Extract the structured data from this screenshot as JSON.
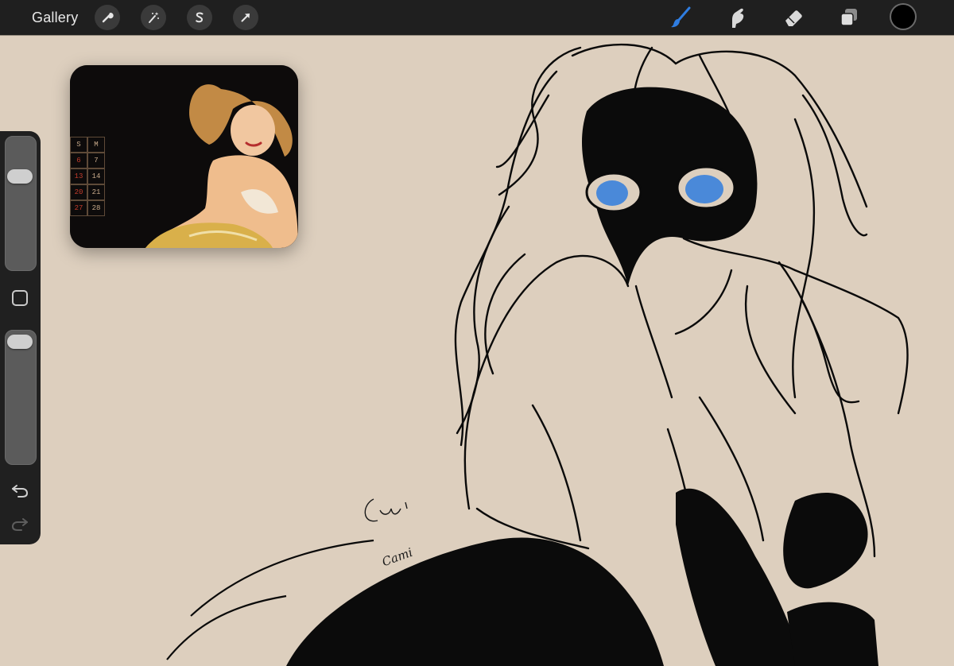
{
  "app": {
    "gallery_label": "Gallery",
    "accent_color": "#2f7de1",
    "current_color": "#000000"
  },
  "toolbar_left": [
    {
      "name": "actions-wrench-icon"
    },
    {
      "name": "adjustments-magic-wand-icon"
    },
    {
      "name": "selection-s-icon"
    },
    {
      "name": "transform-arrow-icon"
    }
  ],
  "toolbar_right": [
    {
      "name": "paint-brush-icon",
      "active": true
    },
    {
      "name": "smudge-finger-icon",
      "active": false
    },
    {
      "name": "eraser-icon",
      "active": false
    },
    {
      "name": "layers-icon",
      "active": false
    }
  ],
  "reference": {
    "calendar": {
      "headers": [
        "S",
        "M"
      ],
      "rows": [
        [
          "6",
          "7"
        ],
        [
          "13",
          "14"
        ],
        [
          "20",
          "21"
        ],
        [
          "27",
          "28"
        ]
      ]
    }
  },
  "canvas": {
    "signature": "Cami"
  },
  "sidebar": {
    "brush_size_level": 0.73,
    "opacity_level": 0.98
  }
}
